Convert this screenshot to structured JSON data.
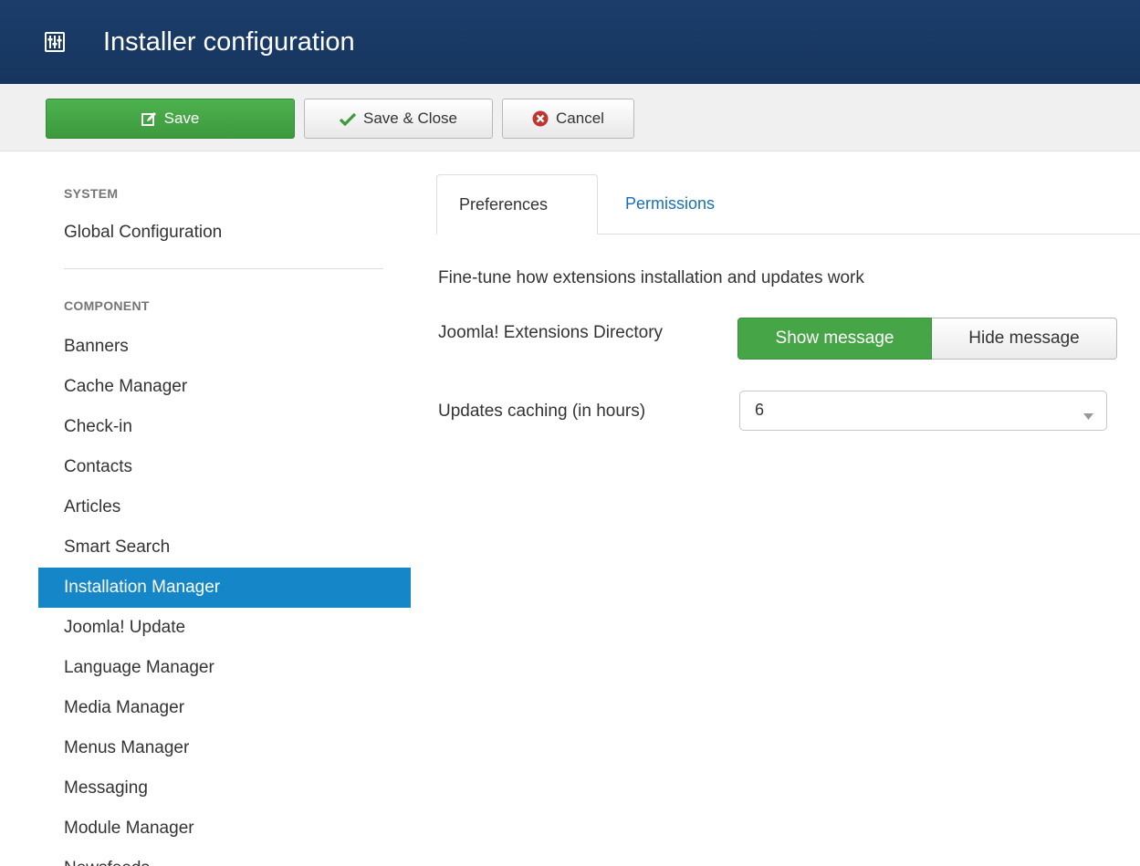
{
  "header": {
    "icon": "equalizer-icon",
    "title": "Installer configuration"
  },
  "toolbar": {
    "save_label": "Save",
    "save_close_label": "Save & Close",
    "cancel_label": "Cancel",
    "save_icon": "edit-icon",
    "save_close_icon": "check-icon",
    "cancel_icon": "cancel-circle-icon"
  },
  "sidebar": {
    "system_header": "SYSTEM",
    "global_config": "Global Configuration",
    "component_header": "COMPONENT",
    "items": [
      {
        "label": "Banners"
      },
      {
        "label": "Cache Manager"
      },
      {
        "label": "Check-in"
      },
      {
        "label": "Contacts"
      },
      {
        "label": "Articles"
      },
      {
        "label": "Smart Search"
      },
      {
        "label": "Installation Manager",
        "active": true
      },
      {
        "label": "Joomla! Update"
      },
      {
        "label": "Language Manager"
      },
      {
        "label": "Media Manager"
      },
      {
        "label": "Menus Manager"
      },
      {
        "label": "Messaging"
      },
      {
        "label": "Module Manager"
      },
      {
        "label": "Newsfeeds"
      }
    ]
  },
  "main": {
    "tabs": [
      {
        "label": "Preferences",
        "active": true
      },
      {
        "label": "Permissions",
        "active": false
      }
    ],
    "description": "Fine-tune how extensions installation and updates work",
    "jed_label": "Joomla! Extensions Directory",
    "jed_options": {
      "show": "Show message",
      "hide": "Hide message",
      "selected": "show"
    },
    "cache_label": "Updates caching (in hours)",
    "cache_value": "6"
  },
  "colors": {
    "header_bg": "#1c3d6b",
    "save_green": "#46a546",
    "active_blue": "#1586c8",
    "link_blue": "#1a6fb3"
  }
}
